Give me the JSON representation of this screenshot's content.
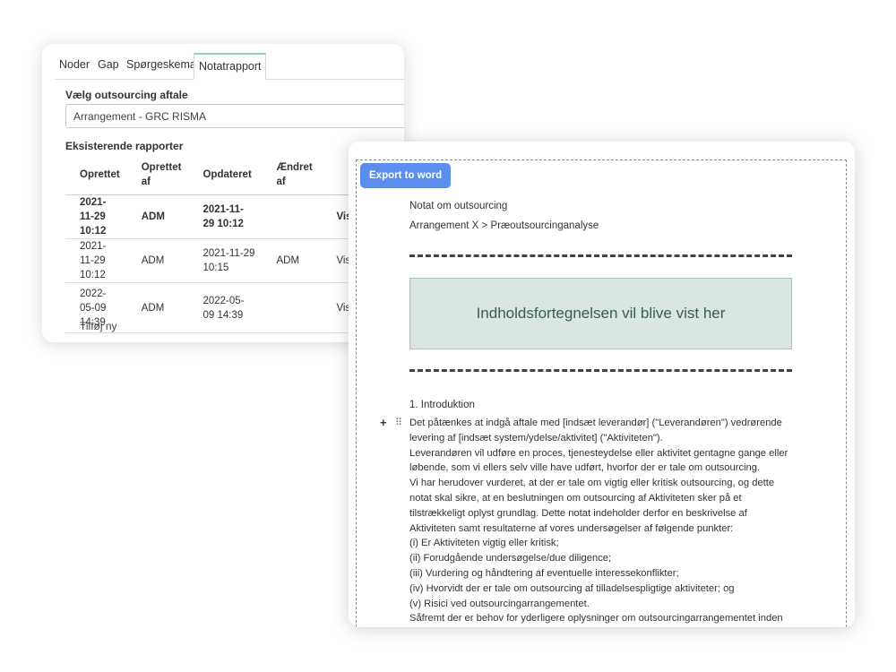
{
  "tabs": [
    "Noder",
    "Gap",
    "Spørgeskema",
    "Notatrapport"
  ],
  "active_tab": "Notatrapport",
  "outsourcing": {
    "label": "Vælg outsourcing aftale",
    "selected": "Arrangement - GRC RISMA"
  },
  "reports": {
    "label": "Eksisterende rapporter",
    "headers": [
      "Oprettet",
      "Oprettet af",
      "Opdateret",
      "Ændret af",
      ""
    ],
    "rows": [
      {
        "created": "2021-11-29 10:12",
        "created_by": "ADM",
        "updated": "2021-11-29 10:12",
        "changed_by": "",
        "action": "Vis"
      },
      {
        "created": "2021-11-29 10:12",
        "created_by": "ADM",
        "updated": "2021-11-29 10:15",
        "changed_by": "ADM",
        "action": "Vis"
      },
      {
        "created": "2022-05-09 14:39",
        "created_by": "ADM",
        "updated": "2022-05-09 14:39",
        "changed_by": "",
        "action": "Vis"
      }
    ],
    "add_new": "Tilføj ny"
  },
  "editor": {
    "export_button": "Export to word",
    "doc_title": "Notat om outsourcing",
    "doc_path": "Arrangement X > Præoutsourcinganalyse",
    "toc_placeholder": "Indholdsfortegnelsen vil blive vist her",
    "intro_heading": "1. Introduktion",
    "paragraphs": [
      "Det påtænkes at indgå aftale med [indsæt leverandør] (\"Leverandøren\") vedrørende levering af [indsæt system/ydelse/aktivitet] (\"Aktiviteten\").",
      "Leverandøren vil udføre en proces, tjenesteydelse eller aktivitet gentagne gange eller løbende, som vi ellers selv ville have udført, hvorfor der er tale om outsourcing.",
      "Vi har herudover vurderet, at der er tale om vigtig eller kritisk outsourcing, og dette notat skal sikre, at en beslutningen om outsourcing af Aktiviteten sker på et tilstrækkeligt oplyst grundlag. Dette notat indeholder derfor en beskrivelse af Aktiviteten samt resultaterne af vores undersøgelser af følgende punkter:",
      "(i) Er Aktiviteten vigtig eller kritisk;",
      "(ii) Forudgående undersøgelse/due diligence;",
      "(iii) Vurdering og håndtering af eventuelle interessekonflikter;",
      "(iv) Hvorvidt der er tale om outsourcing af tilladelsespligtige aktiviteter; og",
      "(v) Risici ved outsourcingarrangementet.",
      "Såfremt der er behov for yderligere oplysninger om outsourcingarrangementet inden"
    ]
  },
  "icons": {
    "plus": "plus-icon",
    "drag": "drag-handle-icon"
  },
  "colors": {
    "tab_accent": "#8fd0c4",
    "export_button": "#5b8def",
    "toc_background": "#d9e6e2"
  }
}
